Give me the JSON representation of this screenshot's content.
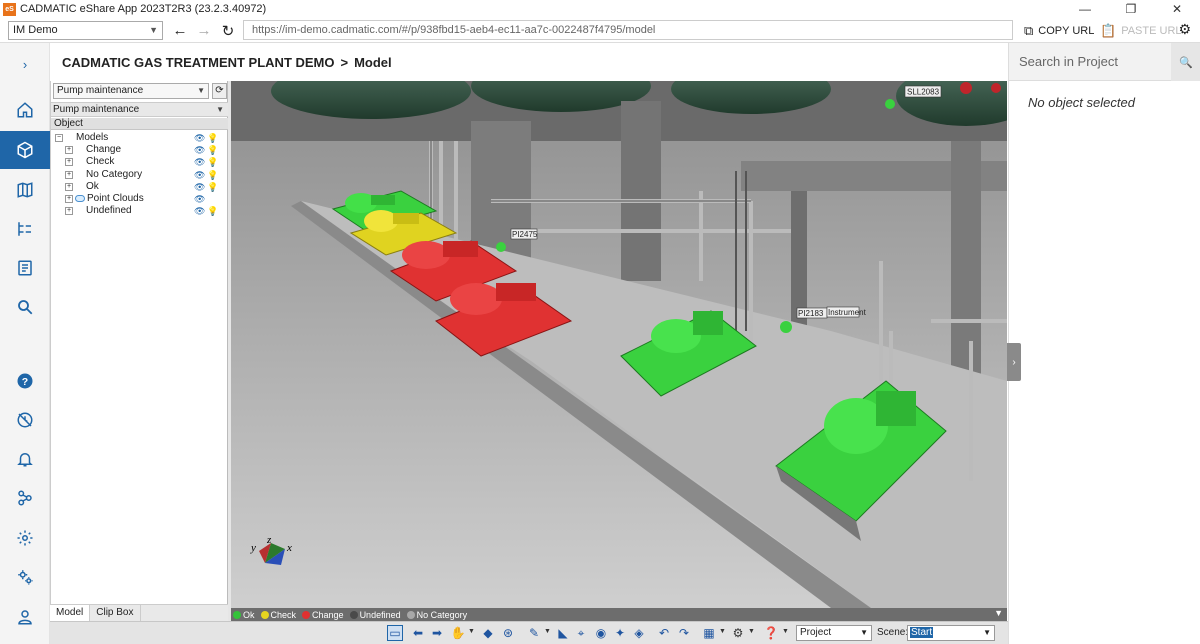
{
  "window": {
    "title": "CADMATIC eShare App 2023T2R3 (23.2.3.40972)",
    "logo_text": "eS",
    "minimize": "—",
    "maximize": "❐",
    "close": "✕"
  },
  "address": {
    "site": "IM Demo",
    "url": "https://im-demo.cadmatic.com/#/p/938fbd15-aeb4-ec11-aa7c-0022487f4795/model",
    "copy_url": "COPY URL",
    "paste_url": "PASTE URL"
  },
  "header": {
    "project": "CADMATIC GAS TREATMENT PLANT DEMO",
    "separator": ">",
    "page": "Model"
  },
  "search": {
    "placeholder": "Search in Project"
  },
  "properties": {
    "empty": "No object selected"
  },
  "tree": {
    "view_select": "Pump maintenance",
    "group_select": "Pump maintenance",
    "column": "Object",
    "root": "Models",
    "items": [
      "Change",
      "Check",
      "No Category",
      "Ok",
      "Point Clouds",
      "Undefined"
    ]
  },
  "tabs": [
    "Model",
    "Clip Box"
  ],
  "legend": [
    {
      "label": "Ok",
      "color": "#34c33a"
    },
    {
      "label": "Check",
      "color": "#e6d51f"
    },
    {
      "label": "Change",
      "color": "#e03030"
    },
    {
      "label": "Undefined",
      "color": "#4a4a4a"
    },
    {
      "label": "No Category",
      "color": "#a8a8a8"
    }
  ],
  "viewport_labels": [
    "SLL2083",
    "PI2475",
    "PI2183",
    "Instrument"
  ],
  "axes": {
    "x": "x",
    "y": "y",
    "z": "z"
  },
  "toolbar": {
    "project_select": "Project",
    "scene_label": "Scene:",
    "scene_value": "Start"
  },
  "colors": {
    "accent": "#1f66a8",
    "ok": "#34c33a",
    "check": "#e6d51f",
    "change": "#e03030"
  }
}
